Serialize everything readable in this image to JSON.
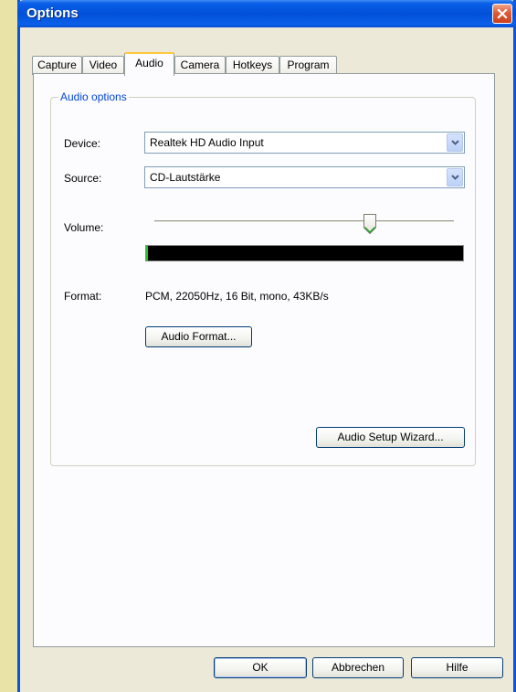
{
  "window": {
    "title": "Options"
  },
  "tabs": [
    {
      "label": "Capture"
    },
    {
      "label": "Video"
    },
    {
      "label": "Audio"
    },
    {
      "label": "Camera"
    },
    {
      "label": "Hotkeys"
    },
    {
      "label": "Program"
    }
  ],
  "active_tab": "Audio",
  "audio_options": {
    "group_label": "Audio options",
    "device_label": "Device:",
    "device_value": "Realtek HD Audio Input",
    "source_label": "Source:",
    "source_value": "CD-Lautstärke",
    "volume_label": "Volume:",
    "volume_level": 0.72,
    "input_level": 0.01,
    "format_label": "Format:",
    "format_value": "PCM, 22050Hz, 16 Bit, mono, 43KB/s",
    "audio_format_button": "Audio Format...",
    "setup_wizard_button": "Audio Setup Wizard..."
  },
  "footer": {
    "ok_button": "OK",
    "cancel_button": "Abbrechen",
    "help_button": "Hilfe"
  },
  "colors": {
    "titlebar": "#0250d8",
    "group_legend": "#0046d5",
    "close_button": "#e05a36",
    "active_tab_highlight": "#ffc83c",
    "level_meter_bg": "#000000",
    "level_meter_fill": "#1ec41e"
  },
  "icons": {
    "close": "close-icon",
    "combo_arrow": "chevron-down-icon",
    "slider_thumb": "slider-thumb-icon"
  }
}
